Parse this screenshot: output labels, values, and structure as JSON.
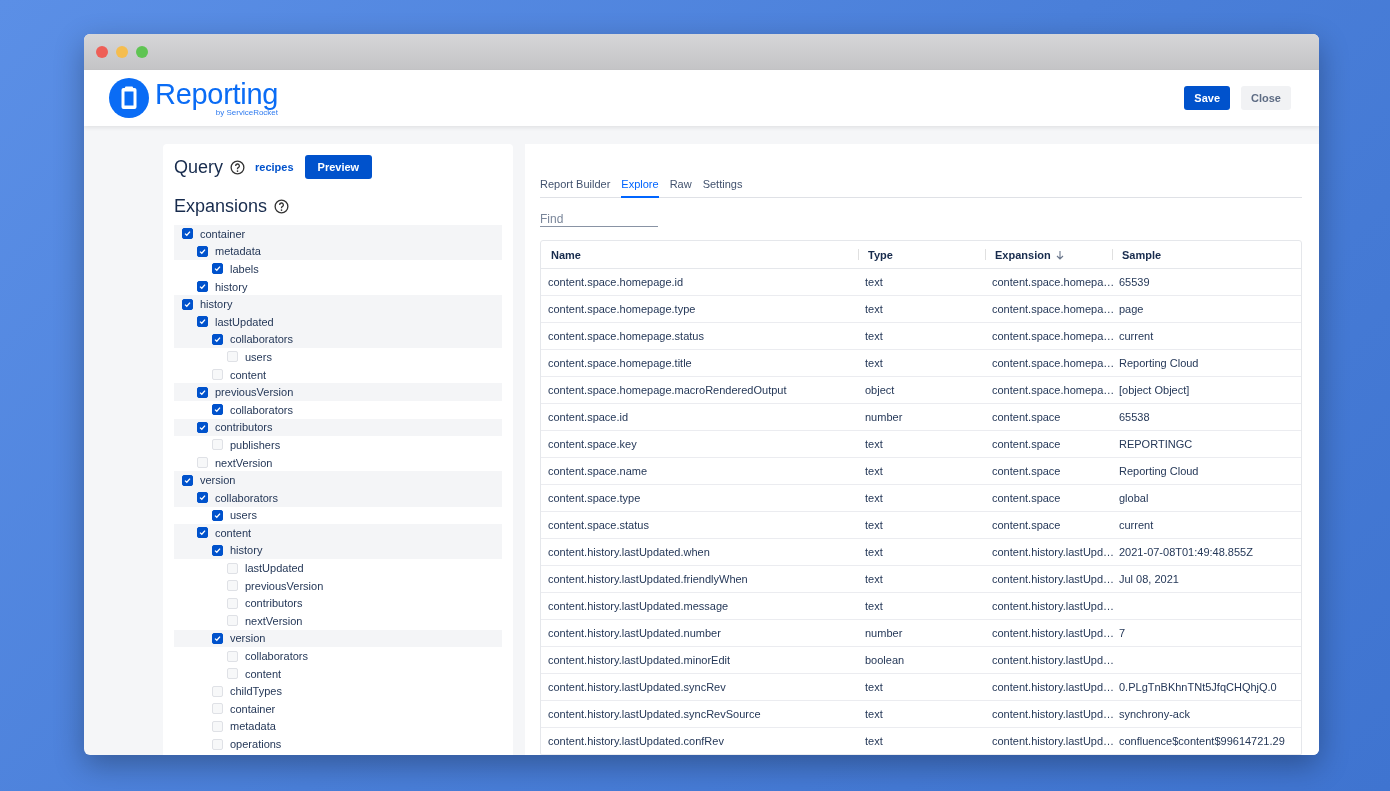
{
  "header": {
    "logo": "Reporting",
    "byline": "by ServiceRocket",
    "buttons": [
      {
        "label": "Save",
        "kind": "primary"
      },
      {
        "label": "Close",
        "kind": "secondary"
      }
    ]
  },
  "query": {
    "title": "Query",
    "link": "recipes",
    "button": "Preview"
  },
  "expansions": {
    "title": "Expansions",
    "items": [
      {
        "label": "container",
        "checked": true,
        "children": [
          {
            "label": "metadata",
            "checked": true,
            "children": [
              {
                "label": "labels",
                "checked": true
              }
            ]
          },
          {
            "label": "history",
            "checked": true
          }
        ]
      },
      {
        "label": "history",
        "checked": true,
        "children": [
          {
            "label": "lastUpdated",
            "checked": true,
            "children": [
              {
                "label": "collaborators",
                "checked": true,
                "children": [
                  {
                    "label": "users",
                    "checked": false
                  }
                ]
              },
              {
                "label": "content",
                "checked": false
              }
            ]
          },
          {
            "label": "previousVersion",
            "checked": true,
            "children": [
              {
                "label": "collaborators",
                "checked": true
              }
            ]
          },
          {
            "label": "contributors",
            "checked": true,
            "children": [
              {
                "label": "publishers",
                "checked": false
              }
            ]
          },
          {
            "label": "nextVersion",
            "checked": false
          }
        ]
      },
      {
        "label": "version",
        "checked": true,
        "children": [
          {
            "label": "collaborators",
            "checked": true,
            "children": [
              {
                "label": "users",
                "checked": true
              }
            ]
          },
          {
            "label": "content",
            "checked": true,
            "children": [
              {
                "label": "history",
                "checked": true,
                "children": [
                  {
                    "label": "lastUpdated",
                    "checked": false
                  },
                  {
                    "label": "previousVersion",
                    "checked": false
                  },
                  {
                    "label": "contributors",
                    "checked": false
                  },
                  {
                    "label": "nextVersion",
                    "checked": false
                  }
                ]
              },
              {
                "label": "version",
                "checked": true,
                "children": [
                  {
                    "label": "collaborators",
                    "checked": false
                  },
                  {
                    "label": "content",
                    "checked": false
                  }
                ]
              },
              {
                "label": "childTypes",
                "checked": false
              },
              {
                "label": "container",
                "checked": false
              },
              {
                "label": "metadata",
                "checked": false
              },
              {
                "label": "operations",
                "checked": false
              }
            ]
          }
        ]
      }
    ]
  },
  "tabs": [
    {
      "label": "Report Builder",
      "selected": false
    },
    {
      "label": "Explore",
      "selected": true
    },
    {
      "label": "Raw",
      "selected": false
    },
    {
      "label": "Settings",
      "selected": false
    }
  ],
  "find": {
    "placeholder": "Find"
  },
  "table": {
    "columns": [
      {
        "label": "Name"
      },
      {
        "label": "Type"
      },
      {
        "label": "Expansion",
        "sorted": true
      },
      {
        "label": "Sample"
      }
    ],
    "rows": [
      {
        "name": "content.space.homepage.id",
        "type": "text",
        "expansion": "content.space.homepa…",
        "sample": "65539"
      },
      {
        "name": "content.space.homepage.type",
        "type": "text",
        "expansion": "content.space.homepa…",
        "sample": "page"
      },
      {
        "name": "content.space.homepage.status",
        "type": "text",
        "expansion": "content.space.homepa…",
        "sample": "current"
      },
      {
        "name": "content.space.homepage.title",
        "type": "text",
        "expansion": "content.space.homepa…",
        "sample": "Reporting Cloud"
      },
      {
        "name": "content.space.homepage.macroRenderedOutput",
        "type": "object",
        "expansion": "content.space.homepa…",
        "sample": "[object Object]"
      },
      {
        "name": "content.space.id",
        "type": "number",
        "expansion": "content.space",
        "sample": "65538"
      },
      {
        "name": "content.space.key",
        "type": "text",
        "expansion": "content.space",
        "sample": "REPORTINGC"
      },
      {
        "name": "content.space.name",
        "type": "text",
        "expansion": "content.space",
        "sample": "Reporting Cloud"
      },
      {
        "name": "content.space.type",
        "type": "text",
        "expansion": "content.space",
        "sample": "global"
      },
      {
        "name": "content.space.status",
        "type": "text",
        "expansion": "content.space",
        "sample": "current"
      },
      {
        "name": "content.history.lastUpdated.when",
        "type": "text",
        "expansion": "content.history.lastUpd…",
        "sample": "2021-07-08T01:49:48.855Z"
      },
      {
        "name": "content.history.lastUpdated.friendlyWhen",
        "type": "text",
        "expansion": "content.history.lastUpd…",
        "sample": "Jul 08, 2021"
      },
      {
        "name": "content.history.lastUpdated.message",
        "type": "text",
        "expansion": "content.history.lastUpd…"
      },
      {
        "name": "content.history.lastUpdated.number",
        "type": "number",
        "expansion": "content.history.lastUpd…",
        "sample": "7"
      },
      {
        "name": "content.history.lastUpdated.minorEdit",
        "type": "boolean",
        "expansion": "content.history.lastUpd…"
      },
      {
        "name": "content.history.lastUpdated.syncRev",
        "type": "text",
        "expansion": "content.history.lastUpd…",
        "sample": "0.PLgTnBKhnTNt5JfqCHQhjQ.0"
      },
      {
        "name": "content.history.lastUpdated.syncRevSource",
        "type": "text",
        "expansion": "content.history.lastUpd…",
        "sample": "synchrony-ack"
      },
      {
        "name": "content.history.lastUpdated.confRev",
        "type": "text",
        "expansion": "content.history.lastUpd…",
        "sample": "confluence$content$99614721.29"
      }
    ]
  }
}
